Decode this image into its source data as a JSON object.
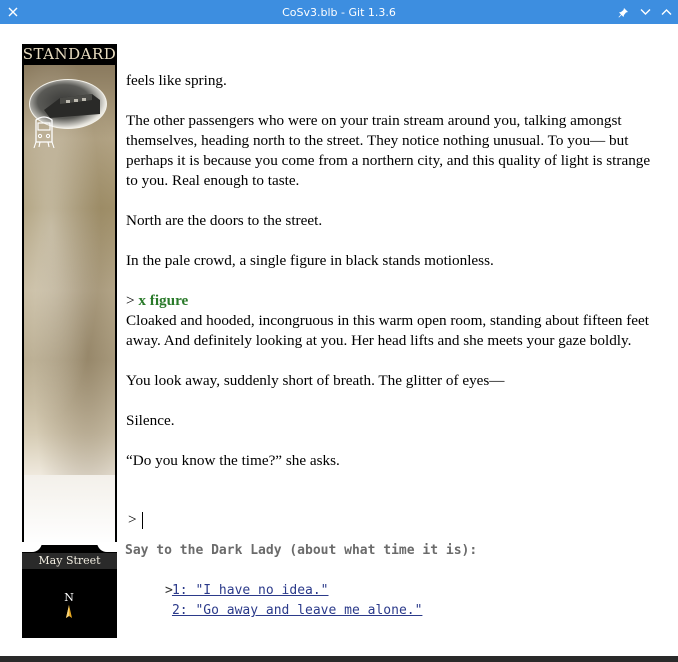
{
  "window": {
    "title": "CoSv3.blb - Git 1.3.6",
    "close_icon": "×",
    "pin_icon": "pin",
    "minimize_icon": "chevron-down",
    "maximize_icon": "chevron-up"
  },
  "sidebar": {
    "header": "STANDARD",
    "location": "May Street",
    "compass_label": "N"
  },
  "story": {
    "paragraphs_before": [
      "feels like spring.",
      "The other passengers who were on your train stream around you, talking amongst themselves, heading north to the street. They notice nothing unusual. To you— but perhaps it is because you come from a northern city, and this quality of light is strange to you. Real enough to taste.",
      "North are the doors to the street.",
      "In the pale crowd, a single figure in black stands motionless."
    ],
    "command_prompt": ">",
    "command_text": "x figure",
    "paragraphs_after": [
      "Cloaked and hooded, incongruous in this warm open room, standing about fifteen feet away. And definitely looking at you. Her head lifts and she meets your gaze boldly.",
      "You look away, suddenly short of breath. The glitter of eyes—",
      "Silence.",
      "“Do you know the time?” she asks."
    ],
    "input_prompt": ">"
  },
  "menu": {
    "title": "Say to the Dark Lady (about what time it is):",
    "selected_marker": ">",
    "options": [
      "1: \"I have no idea.\"",
      "2: \"Go away and leave me alone.\""
    ]
  },
  "colors": {
    "titlebar": "#3d8ee0",
    "command_green": "#2a7a2a",
    "menu_link": "#2b3a8a"
  }
}
